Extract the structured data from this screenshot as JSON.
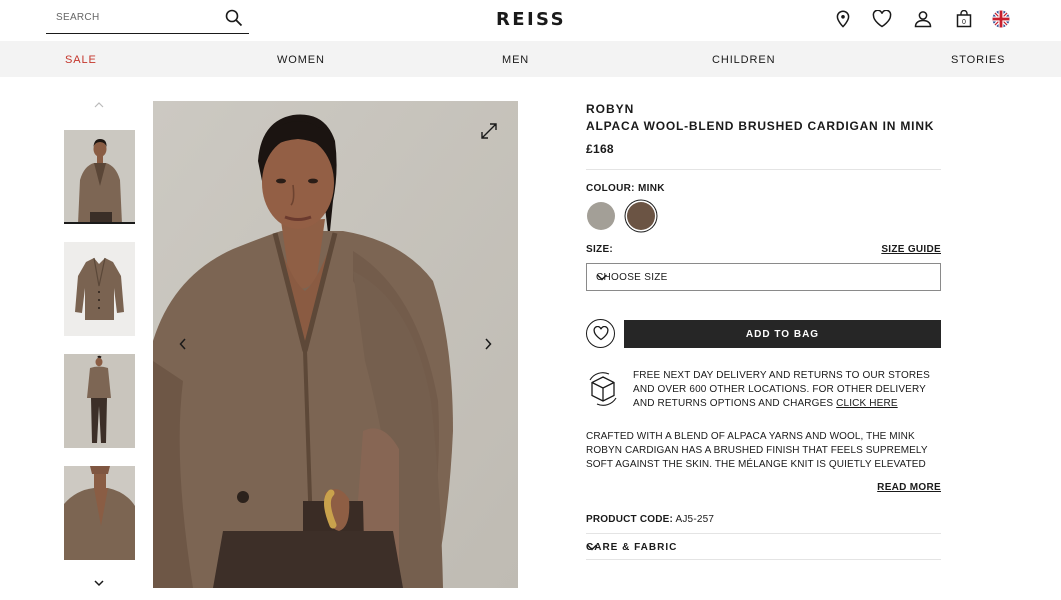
{
  "header": {
    "search_placeholder": "SEARCH",
    "logo": "REISS",
    "icons": [
      "store-locator-icon",
      "heart-icon",
      "account-icon",
      "bag-icon",
      "uk-flag-icon"
    ],
    "bag_count": "0"
  },
  "nav": {
    "items": [
      "SALE",
      "WOMEN",
      "MEN",
      "CHILDREN",
      "STORIES"
    ]
  },
  "gallery": {
    "thumbnails": [
      "thumbnail-model-front",
      "thumbnail-flat-lay",
      "thumbnail-full-length",
      "thumbnail-detail"
    ],
    "selected_index": 0
  },
  "product": {
    "brand": "ROBYN",
    "name": "ALPACA WOOL-BLEND BRUSHED CARDIGAN IN MINK",
    "price": "£168",
    "colour_label": "COLOUR:",
    "colour_value": "MINK",
    "swatches": [
      {
        "name": "grey",
        "color": "#a39f97"
      },
      {
        "name": "mink",
        "color": "#6b5444"
      }
    ],
    "size_label": "SIZE:",
    "size_guide": "SIZE GUIDE",
    "size_placeholder": "CHOOSE SIZE",
    "add_to_bag": "ADD TO BAG",
    "delivery_text": "FREE NEXT DAY DELIVERY AND RETURNS TO OUR STORES AND OVER 600 OTHER LOCATIONS. FOR OTHER DELIVERY AND RETURNS OPTIONS AND CHARGES",
    "delivery_link": "CLICK HERE",
    "description": "CRAFTED WITH A BLEND OF ALPACA YARNS AND WOOL, THE MINK ROBYN CARDIGAN HAS A BRUSHED FINISH THAT FEELS SUPREMELY SOFT AGAINST THE SKIN. THE MÉLANGE KNIT IS QUIETLY ELEVATED BY A TONAL STITCHED…",
    "read_more": "READ MORE",
    "product_code_label": "PRODUCT CODE:",
    "product_code": "AJ5-257",
    "care_label": "CARE & FABRIC"
  },
  "colors": {
    "sale_red": "#c4352b",
    "nav_bg": "#f3f3f3",
    "button_dark": "#262626"
  }
}
